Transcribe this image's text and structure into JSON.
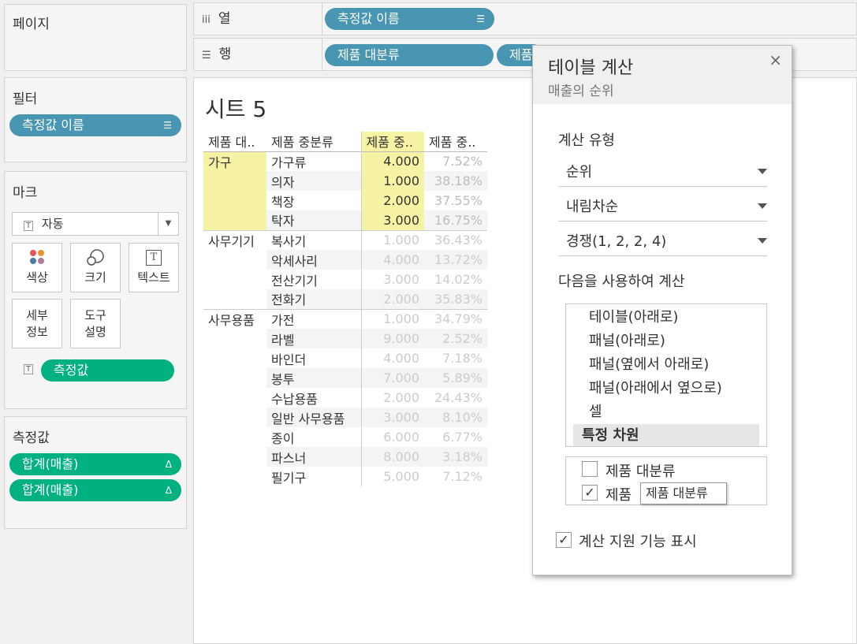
{
  "left": {
    "pages_title": "페이지",
    "filters_title": "필터",
    "filter_pill": "측정값 이름",
    "marks_title": "마크",
    "mark_type": "자동",
    "mark_buttons": {
      "color": "색상",
      "size": "크기",
      "text": "텍스트",
      "detail_line1": "세부",
      "detail_line2": "정보",
      "tooltip_line1": "도구",
      "tooltip_line2": "설명"
    },
    "mark_pill": "측정값",
    "measure_values_title": "측정값",
    "measure_pills": [
      "합계(매출)",
      "합계(매출)"
    ],
    "delta_symbol": "Δ"
  },
  "shelves": {
    "columns_label": "열",
    "rows_label": "행",
    "columns_pill": "측정값 이름",
    "rows_pills": [
      "제품 대분류",
      "제품"
    ]
  },
  "sheet": {
    "title": "시트 5",
    "headers": [
      "제품 대..",
      "제품 중분류",
      "제품 중..",
      "제품 중.."
    ],
    "rows": [
      {
        "cat": "가구",
        "sub": "가구류",
        "rank": "4.000",
        "pct": "7.52%"
      },
      {
        "cat": "",
        "sub": "의자",
        "rank": "1.000",
        "pct": "38.18%"
      },
      {
        "cat": "",
        "sub": "책장",
        "rank": "2.000",
        "pct": "37.55%"
      },
      {
        "cat": "",
        "sub": "탁자",
        "rank": "3.000",
        "pct": "16.75%"
      },
      {
        "cat": "사무기기",
        "sub": "복사기",
        "rank": "1.000",
        "pct": "36.43%"
      },
      {
        "cat": "",
        "sub": "악세사리",
        "rank": "4.000",
        "pct": "13.72%"
      },
      {
        "cat": "",
        "sub": "전산기기",
        "rank": "3.000",
        "pct": "14.02%"
      },
      {
        "cat": "",
        "sub": "전화기",
        "rank": "2.000",
        "pct": "35.83%"
      },
      {
        "cat": "사무용품",
        "sub": "가전",
        "rank": "1.000",
        "pct": "34.79%"
      },
      {
        "cat": "",
        "sub": "라벨",
        "rank": "9.000",
        "pct": "2.52%"
      },
      {
        "cat": "",
        "sub": "바인더",
        "rank": "4.000",
        "pct": "7.18%"
      },
      {
        "cat": "",
        "sub": "봉투",
        "rank": "7.000",
        "pct": "5.89%"
      },
      {
        "cat": "",
        "sub": "수납용품",
        "rank": "2.000",
        "pct": "24.43%"
      },
      {
        "cat": "",
        "sub": "일반 사무용품",
        "rank": "3.000",
        "pct": "8.10%"
      },
      {
        "cat": "",
        "sub": "종이",
        "rank": "6.000",
        "pct": "6.77%"
      },
      {
        "cat": "",
        "sub": "파스너",
        "rank": "8.000",
        "pct": "3.18%"
      },
      {
        "cat": "",
        "sub": "필기구",
        "rank": "5.000",
        "pct": "7.12%"
      }
    ]
  },
  "calc_panel": {
    "title": "테이블 계산",
    "subtitle": "매출의 순위",
    "close": "×",
    "calc_type_label": "계산 유형",
    "calc_type": "순위",
    "order": "내림차순",
    "tie_method": "경쟁(1, 2, 2, 4)",
    "compute_using_label": "다음을 사용하여 계산",
    "compute_options": [
      "테이블(아래로)",
      "패널(아래로)",
      "패널(옆에서 아래로)",
      "패널(아래에서 옆으로)",
      "셀",
      "특정 차원"
    ],
    "dimensions": [
      {
        "label": "제품 대분류",
        "checked": false
      },
      {
        "label": "제품",
        "checked": true
      }
    ],
    "check_mark": "✓",
    "tooltip": "제품 대분류",
    "show_assist": "계산 지원 기능 표시",
    "show_assist_checked": true
  }
}
